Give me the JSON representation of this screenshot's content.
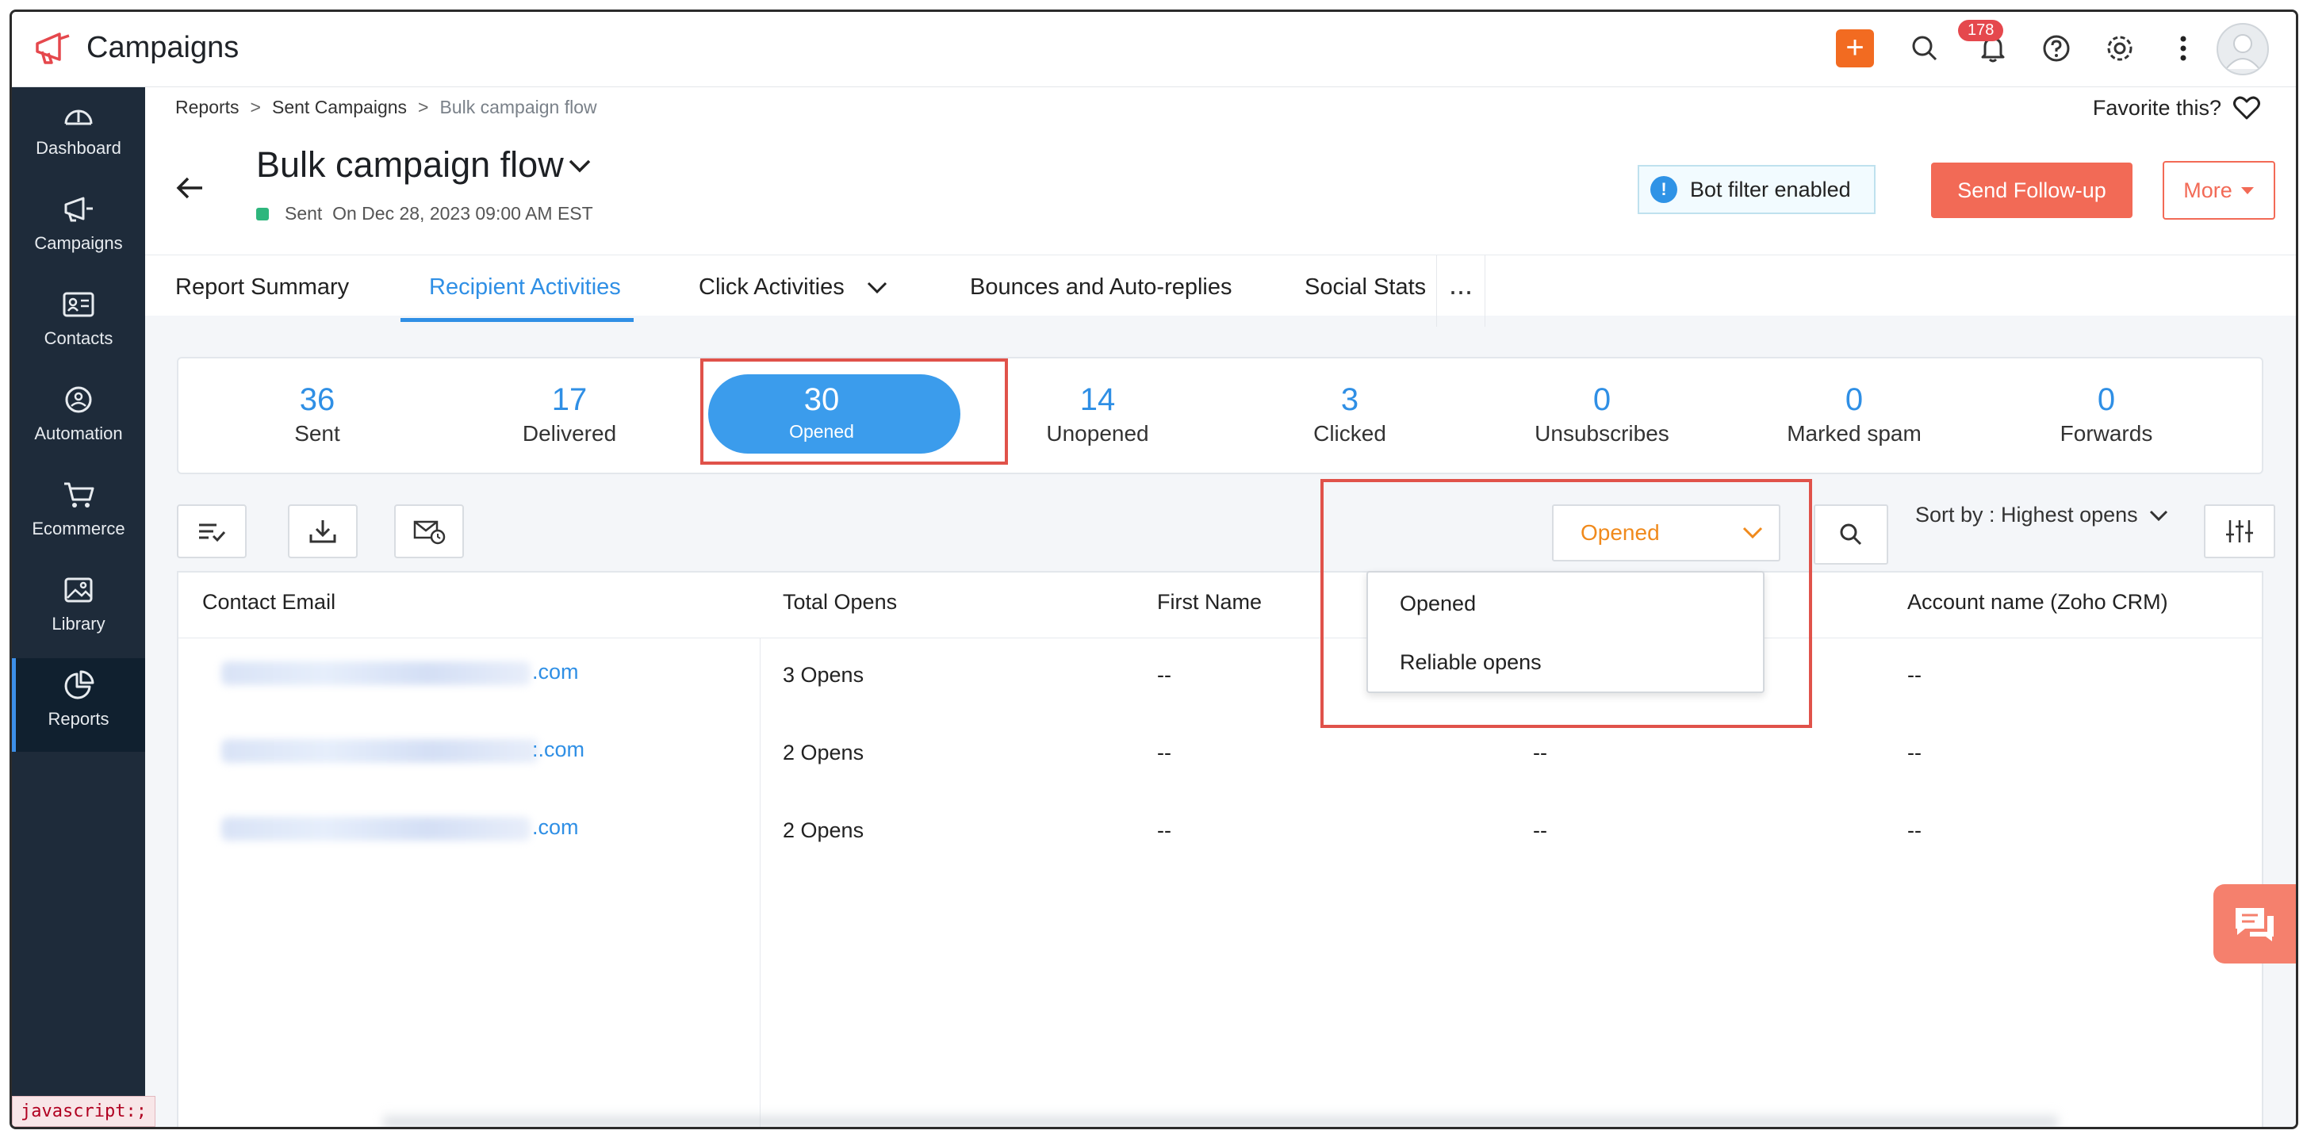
{
  "app": {
    "title": "Campaigns",
    "notification_count": "178"
  },
  "sidebar": {
    "items": [
      {
        "label": "Dashboard",
        "icon": "gauge-icon"
      },
      {
        "label": "Campaigns",
        "icon": "megaphone-icon"
      },
      {
        "label": "Contacts",
        "icon": "contact-card-icon"
      },
      {
        "label": "Automation",
        "icon": "automation-icon"
      },
      {
        "label": "Ecommerce",
        "icon": "cart-icon"
      },
      {
        "label": "Library",
        "icon": "image-icon"
      },
      {
        "label": "Reports",
        "icon": "pie-chart-icon",
        "active": true
      }
    ]
  },
  "breadcrumb": {
    "items": [
      "Reports",
      "Sent Campaigns"
    ],
    "current": "Bulk campaign flow",
    "separator": ">"
  },
  "favorite": {
    "label": "Favorite this?"
  },
  "campaign": {
    "name": "Bulk campaign flow",
    "status": "Sent",
    "sent_on": "On Dec 28, 2023 09:00 AM EST"
  },
  "header_actions": {
    "bot_filter": "Bot filter enabled",
    "follow_up": "Send Follow-up",
    "more": "More"
  },
  "tabs": [
    {
      "label": "Report Summary"
    },
    {
      "label": "Recipient Activities",
      "active": true
    },
    {
      "label": "Click Activities"
    },
    {
      "label": "Bounces and Auto-replies"
    },
    {
      "label": "Social Stats"
    }
  ],
  "tab_more": "...",
  "stats": [
    {
      "value": "36",
      "label": "Sent"
    },
    {
      "value": "17",
      "label": "Delivered"
    },
    {
      "value": "30",
      "label": "Opened",
      "active": true
    },
    {
      "value": "14",
      "label": "Unopened"
    },
    {
      "value": "3",
      "label": "Clicked"
    },
    {
      "value": "0",
      "label": "Unsubscribes"
    },
    {
      "value": "0",
      "label": "Marked spam"
    },
    {
      "value": "0",
      "label": "Forwards"
    }
  ],
  "filter": {
    "selected": "Opened",
    "options": [
      "Opened",
      "Reliable opens"
    ]
  },
  "sort": {
    "label": "Sort by : Highest opens"
  },
  "table": {
    "columns": [
      "Contact Email",
      "Total Opens",
      "First Name",
      "Account name (Zoho CRM)"
    ],
    "rows": [
      {
        "email_suffix": ".com",
        "opens": "3 Opens",
        "first_name": "--",
        "col4": "--",
        "account": "--"
      },
      {
        "email_suffix": ":.com",
        "opens": "2 Opens",
        "first_name": "--",
        "col4": "--",
        "account": "--"
      },
      {
        "email_suffix": ".com",
        "opens": "2 Opens",
        "first_name": "--",
        "col4": "--",
        "account": "--"
      }
    ]
  },
  "status_bar": "javascript:;",
  "colors": {
    "accent": "#2f8fe5",
    "brand_orange": "#f26b21",
    "follow_up": "#f26a56",
    "sidebar": "#1e2b3a",
    "highlight_box": "#e0524a"
  }
}
